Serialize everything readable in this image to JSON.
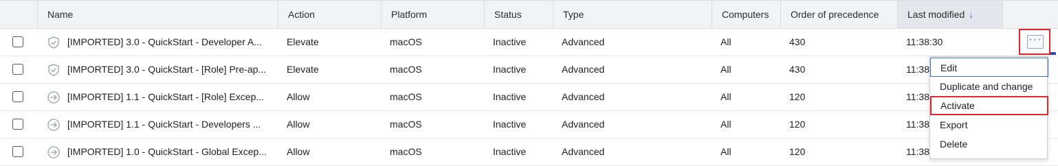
{
  "table": {
    "columns": [
      {
        "key": "name",
        "label": "Name"
      },
      {
        "key": "action",
        "label": "Action"
      },
      {
        "key": "platform",
        "label": "Platform"
      },
      {
        "key": "status",
        "label": "Status"
      },
      {
        "key": "type",
        "label": "Type"
      },
      {
        "key": "computers",
        "label": "Computers"
      },
      {
        "key": "order",
        "label": "Order of precedence"
      },
      {
        "key": "modified",
        "label": "Last modified",
        "sort": "↓"
      }
    ],
    "rows": [
      {
        "icon": "shield-check-icon",
        "name": "[IMPORTED] 3.0 - QuickStart - Developer A...",
        "action": "Elevate",
        "platform": "macOS",
        "status": "Inactive",
        "type": "Advanced",
        "computers": "All",
        "order": "430",
        "modified": "11:38:30"
      },
      {
        "icon": "shield-check-icon",
        "name": "[IMPORTED] 3.0 - QuickStart - [Role] Pre-ap...",
        "action": "Elevate",
        "platform": "macOS",
        "status": "Inactive",
        "type": "Advanced",
        "computers": "All",
        "order": "430",
        "modified": "11:38"
      },
      {
        "icon": "arrow-circle-icon",
        "name": "[IMPORTED] 1.1 - QuickStart - [Role] Excep...",
        "action": "Allow",
        "platform": "macOS",
        "status": "Inactive",
        "type": "Advanced",
        "computers": "All",
        "order": "120",
        "modified": "11:38"
      },
      {
        "icon": "arrow-circle-icon",
        "name": "[IMPORTED] 1.1 - QuickStart - Developers ...",
        "action": "Allow",
        "platform": "macOS",
        "status": "Inactive",
        "type": "Advanced",
        "computers": "All",
        "order": "120",
        "modified": "11:38"
      },
      {
        "icon": "arrow-circle-icon",
        "name": "[IMPORTED] 1.0 - QuickStart - Global Excep...",
        "action": "Allow",
        "platform": "macOS",
        "status": "Inactive",
        "type": "Advanced",
        "computers": "All",
        "order": "120",
        "modified": "11:38"
      }
    ]
  },
  "more_button": {
    "glyph": "···"
  },
  "context_menu": {
    "items": [
      "Edit",
      "Duplicate and change",
      "Activate",
      "Export",
      "Delete"
    ]
  },
  "colors": {
    "accent": "#3b6fd8",
    "highlight": "#e0262b"
  }
}
